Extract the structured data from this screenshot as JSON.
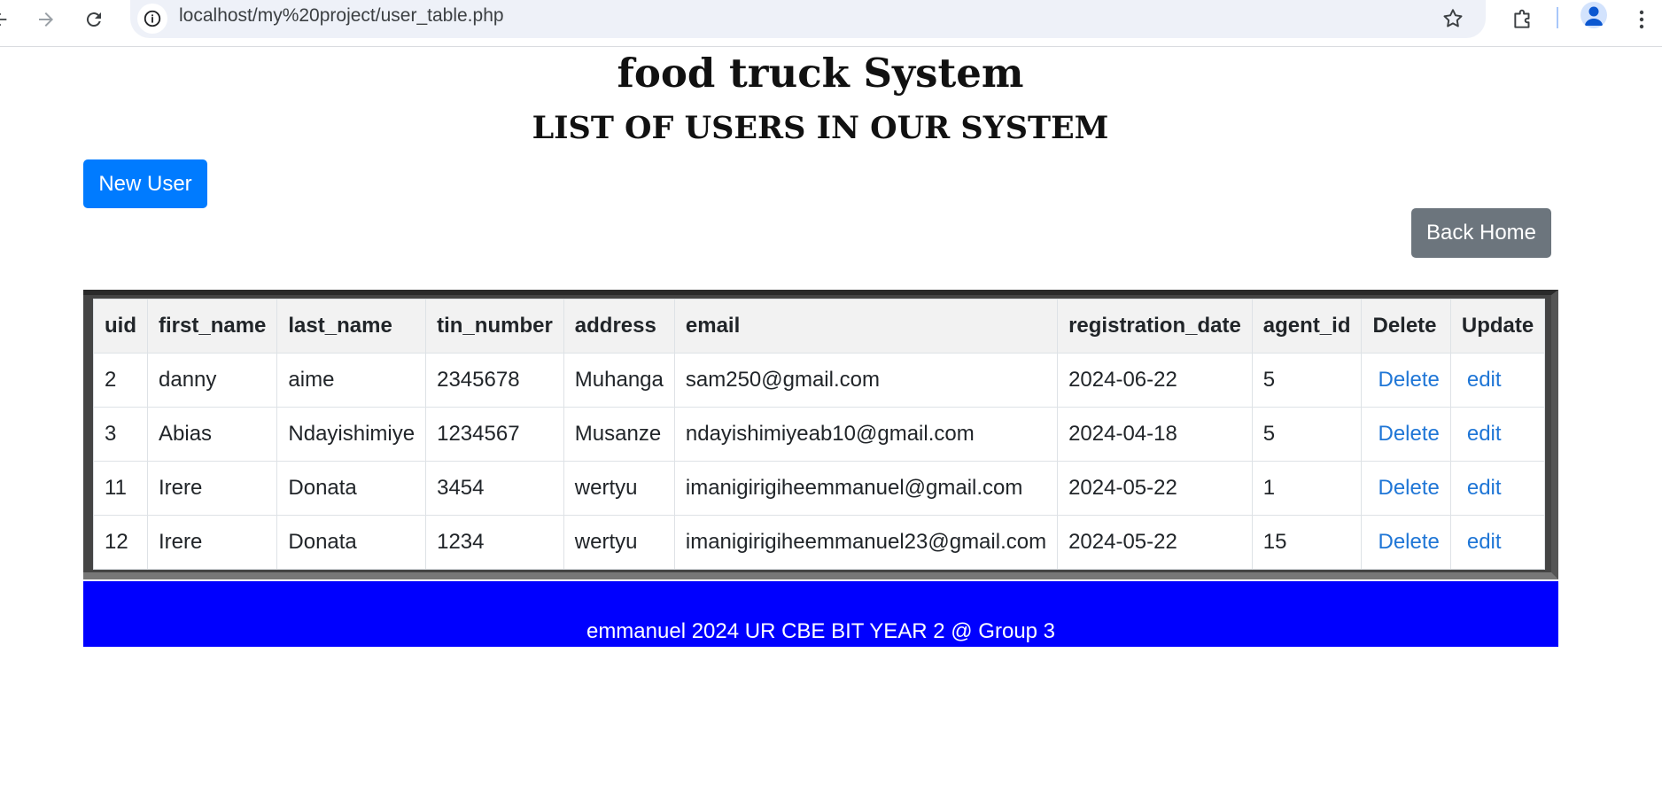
{
  "browser": {
    "url": "localhost/my%20project/user_table.php"
  },
  "page": {
    "title": "food truck System",
    "subtitle": "LIST OF USERS IN OUR SYSTEM",
    "new_user_label": "New User",
    "back_home_label": "Back Home"
  },
  "table": {
    "columns": [
      "uid",
      "first_name",
      "last_name",
      "tin_number",
      "address",
      "email",
      "registration_date",
      "agent_id",
      "Delete",
      "Update"
    ],
    "rows": [
      {
        "uid": "2",
        "first_name": "danny",
        "last_name": "aime",
        "tin_number": "2345678",
        "address": "Muhanga",
        "email": "sam250@gmail.com",
        "registration_date": "2024-06-22",
        "agent_id": "5",
        "delete_label": "Delete",
        "update_label": "edit"
      },
      {
        "uid": "3",
        "first_name": "Abias",
        "last_name": "Ndayishimiye",
        "tin_number": "1234567",
        "address": "Musanze",
        "email": "ndayishimiyeab10@gmail.com",
        "registration_date": "2024-04-18",
        "agent_id": "5",
        "delete_label": "Delete",
        "update_label": "edit"
      },
      {
        "uid": "11",
        "first_name": "Irere",
        "last_name": "Donata",
        "tin_number": "3454",
        "address": "wertyu",
        "email": "imanigirigiheemmanuel@gmail.com",
        "registration_date": "2024-05-22",
        "agent_id": "1",
        "delete_label": "Delete",
        "update_label": "edit"
      },
      {
        "uid": "12",
        "first_name": "Irere",
        "last_name": "Donata",
        "tin_number": "1234",
        "address": "wertyu",
        "email": "imanigirigiheemmanuel23@gmail.com",
        "registration_date": "2024-05-22",
        "agent_id": "15",
        "delete_label": "Delete",
        "update_label": "edit"
      }
    ]
  },
  "footer": {
    "text": "emmanuel 2024 UR CBE BIT YEAR 2 @ Group 3"
  },
  "colors": {
    "primary": "#007bff",
    "secondary": "#6c757d",
    "footer_bg": "#0000ff",
    "link": "#1f76d6"
  },
  "icons": [
    "back-arrow-icon",
    "forward-arrow-icon",
    "reload-icon",
    "site-info-icon",
    "bookmark-star-icon",
    "extensions-icon",
    "profile-icon",
    "menu-dots-icon"
  ]
}
